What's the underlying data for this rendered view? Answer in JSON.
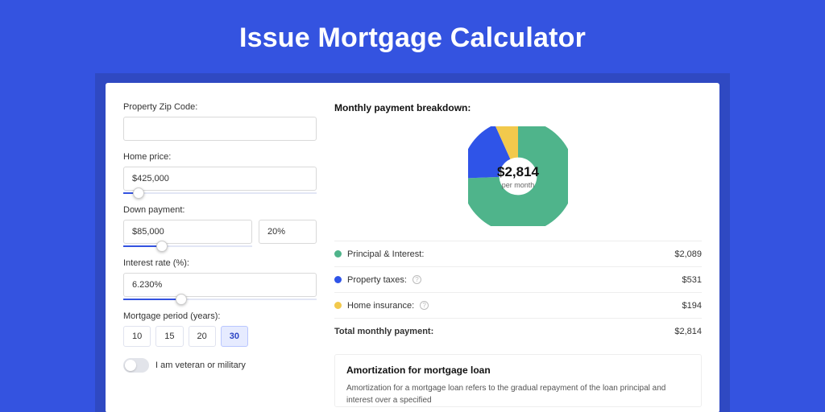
{
  "hero": {
    "title": "Issue Mortgage Calculator"
  },
  "form": {
    "zip_label": "Property Zip Code:",
    "zip_value": "",
    "home_price_label": "Home price:",
    "home_price_value": "$425,000",
    "home_price_slider_pct": 8,
    "down_payment_label": "Down payment:",
    "down_payment_value": "$85,000",
    "down_payment_pct": "20%",
    "down_payment_slider_pct": 30,
    "interest_label": "Interest rate (%):",
    "interest_value": "6.230%",
    "interest_slider_pct": 30,
    "period_label": "Mortgage period (years):",
    "period_options": [
      "10",
      "15",
      "20",
      "30"
    ],
    "period_selected": "30",
    "veteran_label": "I am veteran or military"
  },
  "breakdown": {
    "title": "Monthly payment breakdown:",
    "center_value": "$2,814",
    "center_label": "per month",
    "rows": [
      {
        "label": "Principal & Interest:",
        "value": "$2,089",
        "color": "#4fb48b",
        "info": false
      },
      {
        "label": "Property taxes:",
        "value": "$531",
        "color": "#2f54e8",
        "info": true
      },
      {
        "label": "Home insurance:",
        "value": "$194",
        "color": "#f2c94c",
        "info": true
      }
    ],
    "total_label": "Total monthly payment:",
    "total_value": "$2,814"
  },
  "amort": {
    "title": "Amortization for mortgage loan",
    "text": "Amortization for a mortgage loan refers to the gradual repayment of the loan principal and interest over a specified"
  },
  "chart_data": {
    "type": "pie",
    "title": "Monthly payment breakdown",
    "series": [
      {
        "name": "Principal & Interest",
        "value": 2089,
        "color": "#4fb48b"
      },
      {
        "name": "Property taxes",
        "value": 531,
        "color": "#2f54e8"
      },
      {
        "name": "Home insurance",
        "value": 194,
        "color": "#f2c94c"
      }
    ],
    "total": 2814,
    "center_label": "$2,814 per month"
  }
}
